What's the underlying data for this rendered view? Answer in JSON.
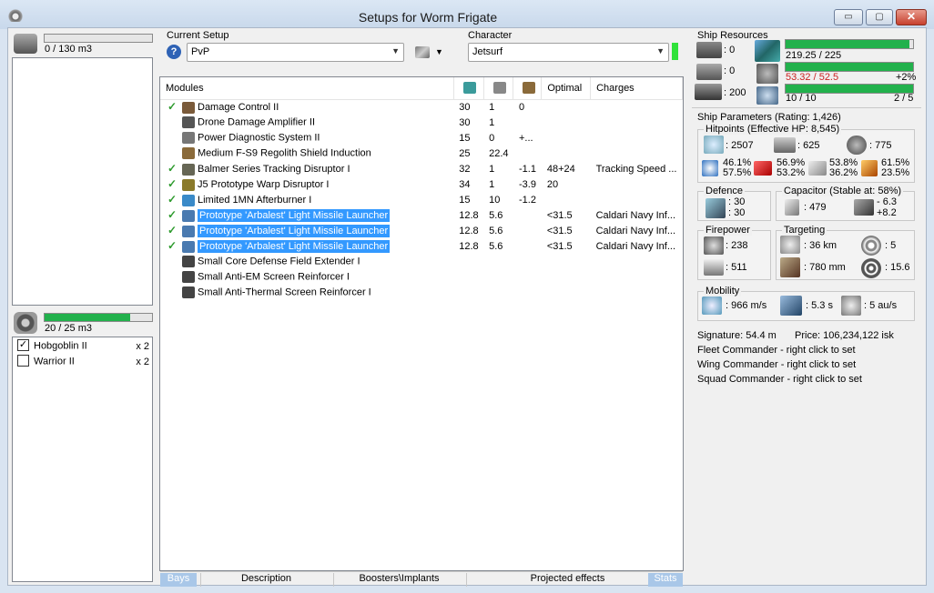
{
  "window": {
    "title": "Setups for Worm Frigate",
    "minimize": "▭",
    "maximize": "▢",
    "close": "✕"
  },
  "cargo": {
    "text": "0 / 130 m3",
    "fill": 0
  },
  "drone_bay": {
    "text": "20 / 25 m3",
    "fill": 0.8,
    "items": [
      {
        "name": "Hobgoblin II",
        "qty": "x 2",
        "checked": true
      },
      {
        "name": "Warrior II",
        "qty": "x 2",
        "checked": false
      }
    ]
  },
  "setup": {
    "label": "Current Setup",
    "value": "PvP",
    "help": "?"
  },
  "character": {
    "label": "Character",
    "value": "Jetsurf"
  },
  "modules": {
    "headers": [
      "Modules",
      "",
      "",
      "",
      "Optimal",
      "Charges"
    ],
    "rows": [
      {
        "ok": "✓",
        "name": "Damage Control II",
        "cpu": "30",
        "pg": "1",
        "cap": "0",
        "optimal": "",
        "charges": "",
        "color": "#7a5a3a",
        "selected": false
      },
      {
        "ok": "",
        "name": "Drone Damage Amplifier II",
        "cpu": "30",
        "pg": "1",
        "cap": "",
        "optimal": "",
        "charges": "",
        "color": "#555",
        "selected": false
      },
      {
        "ok": "",
        "name": "Power Diagnostic System II",
        "cpu": "15",
        "pg": "0",
        "cap": "+...",
        "optimal": "",
        "charges": "",
        "color": "#777",
        "selected": false
      },
      {
        "ok": "",
        "name": "Medium F-S9 Regolith Shield Induction",
        "cpu": "25",
        "pg": "22.4",
        "cap": "",
        "optimal": "",
        "charges": "",
        "color": "#8a6a3a",
        "selected": false
      },
      {
        "ok": "✓",
        "name": "Balmer Series Tracking Disruptor I",
        "cpu": "32",
        "pg": "1",
        "cap": "-1.1",
        "optimal": "48+24",
        "charges": "Tracking Speed ...",
        "color": "#665",
        "selected": false
      },
      {
        "ok": "✓",
        "name": "J5 Prototype Warp Disruptor I",
        "cpu": "34",
        "pg": "1",
        "cap": "-3.9",
        "optimal": "20",
        "charges": "",
        "color": "#8a7a2a",
        "selected": false
      },
      {
        "ok": "✓",
        "name": "Limited 1MN Afterburner I",
        "cpu": "15",
        "pg": "10",
        "cap": "-1.2",
        "optimal": "",
        "charges": "",
        "color": "#3a8ac8",
        "selected": false
      },
      {
        "ok": "✓",
        "name": "Prototype 'Arbalest' Light Missile Launcher",
        "cpu": "12.8",
        "pg": "5.6",
        "cap": "",
        "optimal": "<31.5",
        "charges": "Caldari Navy Inf...",
        "color": "#4a7ab0",
        "selected": true
      },
      {
        "ok": "✓",
        "name": "Prototype 'Arbalest' Light Missile Launcher",
        "cpu": "12.8",
        "pg": "5.6",
        "cap": "",
        "optimal": "<31.5",
        "charges": "Caldari Navy Inf...",
        "color": "#4a7ab0",
        "selected": true
      },
      {
        "ok": "✓",
        "name": "Prototype 'Arbalest' Light Missile Launcher",
        "cpu": "12.8",
        "pg": "5.6",
        "cap": "",
        "optimal": "<31.5",
        "charges": "Caldari Navy Inf...",
        "color": "#4a7ab0",
        "selected": true
      },
      {
        "ok": "",
        "name": "Small Core Defense Field Extender I",
        "cpu": "",
        "pg": "",
        "cap": "",
        "optimal": "",
        "charges": "",
        "color": "#444",
        "selected": false
      },
      {
        "ok": "",
        "name": "Small Anti-EM Screen Reinforcer I",
        "cpu": "",
        "pg": "",
        "cap": "",
        "optimal": "",
        "charges": "",
        "color": "#444",
        "selected": false
      },
      {
        "ok": "",
        "name": "Small Anti-Thermal Screen Reinforcer I",
        "cpu": "",
        "pg": "",
        "cap": "",
        "optimal": "",
        "charges": "",
        "color": "#444",
        "selected": false
      }
    ]
  },
  "tabs": {
    "bays": "Bays",
    "description": "Description",
    "boosters": "Boosters\\Implants",
    "projected": "Projected effects",
    "stats": "Stats"
  },
  "resources": {
    "label": "Ship Resources",
    "hardpoints": [
      ": 0",
      ": 0",
      ": 200"
    ],
    "cpu": {
      "text": "219.25 / 225",
      "fill": 0.974
    },
    "pg": {
      "text": "53.32 / 52.5",
      "extra": "+2%",
      "fill": 1.0,
      "color": "#cc2222"
    },
    "calib": {
      "text": "10 / 10",
      "extra": "2 / 5",
      "fill": 1.0
    }
  },
  "params": {
    "label": "Ship Parameters (Rating: 1,426)",
    "hp_label": "Hitpoints (Effective HP: 8,545)",
    "hp": [
      ": 2507",
      ": 625",
      ": 775"
    ],
    "res": [
      [
        "46.1%",
        "57.5%"
      ],
      [
        "56.9%",
        "53.2%"
      ],
      [
        "53.8%",
        "36.2%"
      ],
      [
        "61.5%",
        "23.5%"
      ]
    ],
    "defence_label": "Defence",
    "defence": [
      ": 30",
      ": 30"
    ],
    "cap_label": "Capacitor (Stable at: 58%)",
    "cap": ": 479",
    "cap_delta": [
      "- 6.3",
      "+8.2"
    ],
    "fire_label": "Firepower",
    "fire": [
      ": 238",
      ": 511"
    ],
    "target_label": "Targeting",
    "target": [
      ": 36 km",
      ": 5",
      ": 780 mm",
      ": 15.6"
    ],
    "mobility_label": "Mobility",
    "mobility": [
      ": 966 m/s",
      ": 5.3 s",
      ": 5 au/s"
    ],
    "signature": "Signature: 54.4 m",
    "price": "Price: 106,234,122 isk",
    "fleet": "Fleet Commander - right click to set",
    "wing": "Wing Commander - right click to set",
    "squad": "Squad Commander - right click to set"
  }
}
